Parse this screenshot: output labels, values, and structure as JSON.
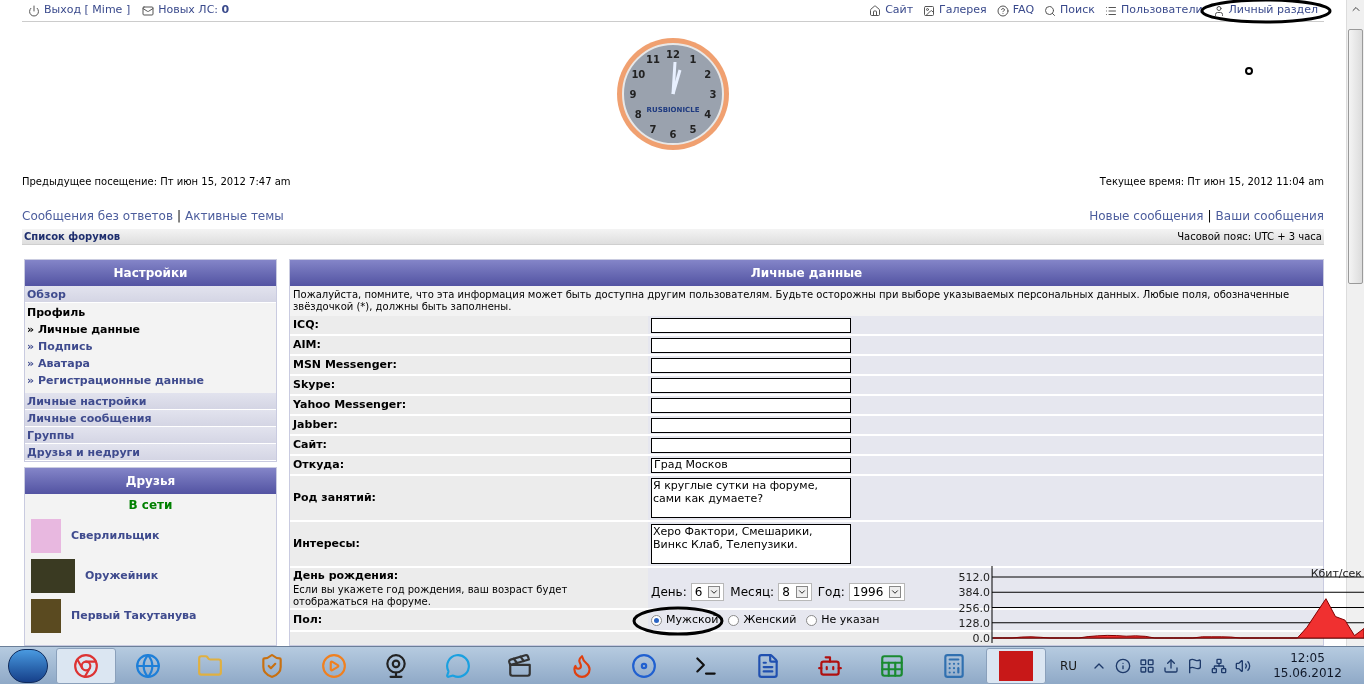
{
  "top_bar": {
    "left": [
      {
        "kind": "logout",
        "text": "Выход [ Mime ]"
      },
      {
        "kind": "messages",
        "text": "Новых ЛС: **0**"
      }
    ],
    "right": [
      {
        "kind": "site",
        "text": "Сайт"
      },
      {
        "kind": "gallery",
        "text": "Галерея"
      },
      {
        "kind": "faq",
        "text": "FAQ"
      },
      {
        "kind": "search",
        "text": "Поиск"
      },
      {
        "kind": "users",
        "text": "Пользователи"
      },
      {
        "kind": "profile",
        "text": "Личный раздел"
      }
    ]
  },
  "logo": {
    "numbers": [
      "12",
      "1",
      "2",
      "3",
      "4",
      "5",
      "6",
      "7",
      "8",
      "9",
      "10",
      "11"
    ],
    "text": "RUSBIONICLE"
  },
  "last_visit": "Предыдущее посещение: Пт июн 15, 2012 7:47 am",
  "current_time": "Текущее время: Пт июн 15, 2012 11:04 am",
  "separator": "|",
  "links_left": [
    "Сообщения без ответов",
    "Активные темы"
  ],
  "links_right": [
    "Новые сообщения",
    "Ваши сообщения"
  ],
  "breadcrumb": "Список форумов",
  "timezone": "Часовой пояс: UTC + 3 часа",
  "settings": {
    "title": "Настройки",
    "items": [
      {
        "label": "Обзор",
        "kind": "section"
      },
      {
        "label": "Профиль",
        "kind": "group",
        "children": [
          {
            "label": "» Личные данные",
            "selected": true
          },
          {
            "label": "» Подпись",
            "selected": false
          },
          {
            "label": "» Аватара",
            "selected": false
          },
          {
            "label": "» Регистрационные данные",
            "selected": false
          }
        ]
      },
      {
        "label": "Личные настройки",
        "kind": "section"
      },
      {
        "label": "Личные сообщения",
        "kind": "section"
      },
      {
        "label": "Группы",
        "kind": "section"
      },
      {
        "label": "Друзья и недруги",
        "kind": "section"
      }
    ]
  },
  "friends": {
    "title": "Друзья",
    "status": "В сети",
    "items": [
      {
        "name": "Сверлильщик"
      },
      {
        "name": "Оружейник"
      },
      {
        "name": "Первый Такутанува"
      }
    ]
  },
  "panel": {
    "title": "Личные данные",
    "notice": "Пожалуйста, помните, что эта информация может быть доступна другим пользователям. Будьте осторожны при выборе указываемых персональных данных. Любые поля, обозначенные звёздочкой (*), должны быть заполнены.",
    "fields": [
      {
        "label": "ICQ:",
        "kind": "text"
      },
      {
        "label": "AIM:",
        "kind": "text"
      },
      {
        "label": "MSN Messenger:",
        "kind": "text"
      },
      {
        "label": "Skype:",
        "kind": "text"
      },
      {
        "label": "Yahoo Messenger:",
        "kind": "text"
      },
      {
        "label": "Jabber:",
        "kind": "text"
      },
      {
        "label": "Сайт:",
        "kind": "text"
      },
      {
        "label": "Откуда:",
        "kind": "text",
        "value": "Град Москов"
      },
      {
        "label": "Род занятий:",
        "kind": "textarea",
        "value": "Я круглые сутки на форуме, сами как думаете?"
      },
      {
        "label": "Интересы:",
        "kind": "textarea",
        "value": "Херо Фактори, Смешарики, Винкс Клаб, Телепузики."
      },
      {
        "label": "День рождения:",
        "kind": "date",
        "hint": "Если вы укажете год рождения, ваш возраст будет отображаться на форуме.",
        "selects": [
          {
            "label": "День:",
            "value": "6"
          },
          {
            "label": "Месяц:",
            "value": "8"
          },
          {
            "label": "Год:",
            "value": "1996"
          }
        ]
      },
      {
        "label": "Пол:",
        "kind": "radio",
        "options": [
          {
            "label": "Мужской",
            "selected": true
          },
          {
            "label": "Женский",
            "selected": false
          },
          {
            "label": "Не указан",
            "selected": false
          }
        ]
      }
    ]
  },
  "network_monitor": {
    "chart_data": {
      "type": "area",
      "grid": true,
      "ylabel": "Кбит/сек",
      "ylim": [
        0,
        512
      ],
      "yticks": [
        {
          "value": 0,
          "label": "0.0"
        },
        {
          "value": 128,
          "label": "128.0"
        },
        {
          "value": 256,
          "label": "256.0"
        },
        {
          "value": 384,
          "label": "384.0"
        },
        {
          "value": 512,
          "label": "512.0"
        }
      ],
      "values": [
        0,
        0,
        0,
        8,
        10,
        6,
        0,
        0,
        0,
        0,
        12,
        18,
        22,
        20,
        15,
        18,
        14,
        0,
        0,
        0,
        0,
        0,
        10,
        10,
        10,
        8,
        0,
        0,
        0,
        0,
        0,
        0,
        0,
        90,
        210,
        330,
        180,
        150,
        20,
        80
      ]
    }
  },
  "taskbar": {
    "apps": [
      {
        "active": true
      },
      {
        "active": false
      },
      {
        "active": false
      },
      {
        "active": false
      },
      {
        "active": false
      },
      {
        "active": false
      },
      {
        "active": false
      },
      {
        "active": false
      },
      {
        "active": false
      },
      {
        "active": false
      },
      {
        "active": false
      },
      {
        "active": false
      },
      {
        "active": false
      },
      {
        "active": false
      },
      {
        "active": false
      },
      {
        "active": true
      }
    ],
    "language": "RU",
    "time": "12:05",
    "date": "15.06.2012"
  }
}
